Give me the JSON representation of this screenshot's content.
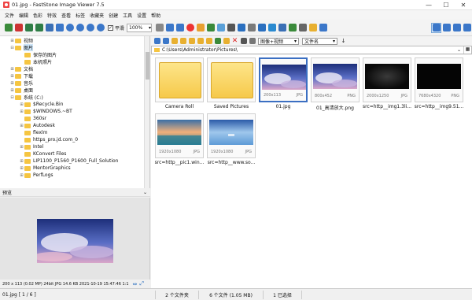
{
  "window": {
    "title": "01.jpg - FastStone Image Viewer 7.5",
    "controls": [
      "—",
      "☐",
      "✕"
    ]
  },
  "menu": [
    "文件",
    "编辑",
    "色彩",
    "特效",
    "查看",
    "标签",
    "收藏夹",
    "创建",
    "工具",
    "设置",
    "帮助"
  ],
  "toolbar": {
    "zoom": "100%",
    "smooth_label": "平滑",
    "smooth_checked": true
  },
  "tree": [
    {
      "label": "视频",
      "indent": 1,
      "exp": "⊞"
    },
    {
      "label": "图片",
      "indent": 1,
      "exp": "⊟",
      "selected": true
    },
    {
      "label": "保存的图片",
      "indent": 2,
      "exp": ""
    },
    {
      "label": "本机照片",
      "indent": 2,
      "exp": ""
    },
    {
      "label": "文档",
      "indent": 1,
      "exp": "⊞"
    },
    {
      "label": "下载",
      "indent": 1,
      "exp": "⊞"
    },
    {
      "label": "音乐",
      "indent": 1,
      "exp": "⊞"
    },
    {
      "label": "桌面",
      "indent": 1,
      "exp": "⊞"
    },
    {
      "label": "系统 (C:)",
      "indent": 1,
      "exp": "⊟"
    },
    {
      "label": "$Recycle.Bin",
      "indent": 2,
      "exp": "⊞"
    },
    {
      "label": "$WINDOWS.~BT",
      "indent": 2,
      "exp": "⊞"
    },
    {
      "label": "360sr",
      "indent": 2,
      "exp": ""
    },
    {
      "label": "Autodesk",
      "indent": 2,
      "exp": "⊞"
    },
    {
      "label": "flexlm",
      "indent": 2,
      "exp": ""
    },
    {
      "label": "https_pro.jd.com_0",
      "indent": 2,
      "exp": ""
    },
    {
      "label": "Intel",
      "indent": 2,
      "exp": "⊞"
    },
    {
      "label": "KConvert Files",
      "indent": 2,
      "exp": ""
    },
    {
      "label": "LIP1100_P1560_P1600_Full_Solution",
      "indent": 2,
      "exp": "⊞"
    },
    {
      "label": "MentorGraphics",
      "indent": 2,
      "exp": "⊞"
    },
    {
      "label": "PerfLogs",
      "indent": 2,
      "exp": "⊞"
    }
  ],
  "preview": {
    "header": "预览",
    "collapse": "⌄"
  },
  "image_info": "200 x 113 (0.02 MP)  24bit  JPG   14.6 KB   2021-10-19 15:47:46  1:1",
  "browser": {
    "filter": "图像+视频",
    "sort": "文件名",
    "path": "C:\\Users\\Administrator\\Pictures\\"
  },
  "thumbs": [
    {
      "caption": "Camera Roll",
      "type": "folder",
      "dims": "",
      "ext": ""
    },
    {
      "caption": "Saved Pictures",
      "type": "folder",
      "dims": "",
      "ext": ""
    },
    {
      "caption": "01.jpg",
      "type": "sky",
      "dims": "200x113",
      "ext": "JPG",
      "selected": true
    },
    {
      "caption": "01_高清放大.png",
      "type": "sky",
      "dims": "800x452",
      "ext": "PNG"
    },
    {
      "caption": "src=http__img1.3li...",
      "type": "dark",
      "dims": "2000x1250",
      "ext": "JPG"
    },
    {
      "caption": "src=http__img9.51...",
      "type": "black",
      "dims": "7680x4320",
      "ext": "PNG"
    },
    {
      "caption": "src=http__pic1.win...",
      "type": "sunset",
      "dims": "1920x1080",
      "ext": "JPG"
    },
    {
      "caption": "src=http__www.so...",
      "type": "sea",
      "dims": "1920x1080",
      "ext": "JPG"
    }
  ],
  "status": {
    "index": "01.jpg [ 1 / 6 ]",
    "folders": "2 个文件夹",
    "files": "6 个文件 (1.05 MB)",
    "selected": "1 已选择"
  }
}
